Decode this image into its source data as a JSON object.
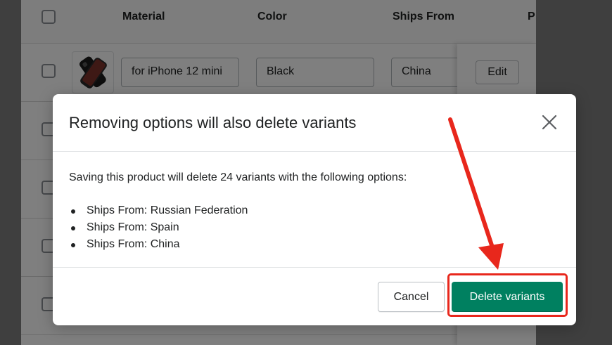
{
  "table": {
    "headers": {
      "material": "Material",
      "color": "Color",
      "ships_from": "Ships From",
      "price_partial": "P"
    },
    "first_row": {
      "material": "for iPhone 12 mini",
      "color": "Black",
      "ships_from": "China",
      "edit_label": "Edit"
    }
  },
  "modal": {
    "title": "Removing options will also delete variants",
    "body_text": "Saving this product will delete 24 variants with the following options:",
    "options": [
      "Ships From: Russian Federation",
      "Ships From: Spain",
      "Ships From: China"
    ],
    "cancel_label": "Cancel",
    "delete_label": "Delete variants",
    "close_icon": "close-icon"
  },
  "colors": {
    "primary": "#008060",
    "annotation": "#e8271c"
  }
}
